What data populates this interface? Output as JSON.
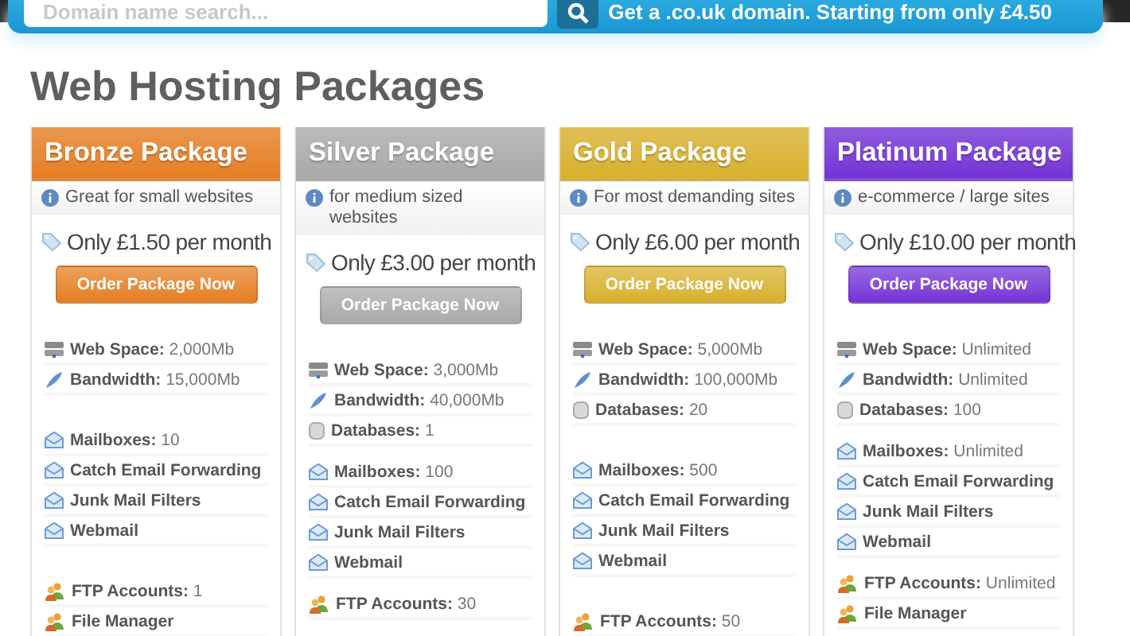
{
  "top_bar": {
    "search_placeholder": "Domain name search...",
    "promo": "Get a .co.uk domain. Starting from only £4.50"
  },
  "heading": "Web Hosting Packages",
  "packages": [
    {
      "name": "Bronze Package",
      "color": "#e57e22",
      "tagline": "Great for small websites",
      "price": "Only £1.50 per month",
      "button": "Order Package Now",
      "groups": [
        [
          {
            "kind": "server",
            "label": "Web Space:",
            "value": "2,000Mb"
          },
          {
            "kind": "bandwidth",
            "label": "Bandwidth:",
            "value": "15,000Mb"
          },
          {
            "kind": "spacer"
          }
        ],
        [
          {
            "kind": "mail",
            "label": "Mailboxes:",
            "value": "10"
          },
          {
            "kind": "mail",
            "label": "Catch Email Forwarding"
          },
          {
            "kind": "mail",
            "label": "Junk Mail Filters"
          },
          {
            "kind": "mail",
            "label": "Webmail"
          },
          {
            "kind": "spacer"
          }
        ],
        [
          {
            "kind": "ftp",
            "label": "FTP Accounts:",
            "value": "1"
          },
          {
            "kind": "ftp",
            "label": "File Manager"
          }
        ]
      ]
    },
    {
      "name": "Silver Package",
      "color": "#a9a9a9",
      "tagline": "for medium sized websites",
      "price": "Only £3.00 per month",
      "button": "Order Package Now",
      "groups": [
        [
          {
            "kind": "server",
            "label": "Web Space:",
            "value": "3,000Mb"
          },
          {
            "kind": "bandwidth",
            "label": "Bandwidth:",
            "value": "40,000Mb"
          },
          {
            "kind": "database",
            "label": "Databases:",
            "value": "1"
          }
        ],
        [
          {
            "kind": "mail",
            "label": "Mailboxes:",
            "value": "100"
          },
          {
            "kind": "mail",
            "label": "Catch Email Forwarding"
          },
          {
            "kind": "mail",
            "label": "Junk Mail Filters"
          },
          {
            "kind": "mail",
            "label": "Webmail"
          }
        ],
        [
          {
            "kind": "ftp",
            "label": "FTP Accounts:",
            "value": "30"
          }
        ]
      ]
    },
    {
      "name": "Gold Package",
      "color": "#d8b02c",
      "tagline": "For most demanding sites",
      "price": "Only £6.00 per month",
      "button": "Order Package Now",
      "groups": [
        [
          {
            "kind": "server",
            "label": "Web Space:",
            "value": "5,000Mb"
          },
          {
            "kind": "bandwidth",
            "label": "Bandwidth:",
            "value": "100,000Mb"
          },
          {
            "kind": "database",
            "label": "Databases:",
            "value": "20"
          },
          {
            "kind": "spacer"
          }
        ],
        [
          {
            "kind": "mail",
            "label": "Mailboxes:",
            "value": "500"
          },
          {
            "kind": "mail",
            "label": "Catch Email Forwarding"
          },
          {
            "kind": "mail",
            "label": "Junk Mail Filters"
          },
          {
            "kind": "mail",
            "label": "Webmail"
          },
          {
            "kind": "spacer"
          }
        ],
        [
          {
            "kind": "ftp",
            "label": "FTP Accounts:",
            "value": "50"
          }
        ]
      ]
    },
    {
      "name": "Platinum Package",
      "color": "#7433d6",
      "tagline": "e-commerce / large sites",
      "price": "Only £10.00 per month",
      "button": "Order Package Now",
      "groups": [
        [
          {
            "kind": "server",
            "label": "Web Space:",
            "value": "Unlimited"
          },
          {
            "kind": "bandwidth",
            "label": "Bandwidth:",
            "value": "Unlimited"
          },
          {
            "kind": "database",
            "label": "Databases:",
            "value": "100"
          }
        ],
        [
          {
            "kind": "mail",
            "label": "Mailboxes:",
            "value": "Unlimited"
          },
          {
            "kind": "mail",
            "label": "Catch Email Forwarding"
          },
          {
            "kind": "mail",
            "label": "Junk Mail Filters"
          },
          {
            "kind": "mail",
            "label": "Webmail"
          }
        ],
        [
          {
            "kind": "ftp",
            "label": "FTP Accounts:",
            "value": "Unlimited"
          },
          {
            "kind": "ftp",
            "label": "File Manager"
          }
        ]
      ]
    }
  ]
}
